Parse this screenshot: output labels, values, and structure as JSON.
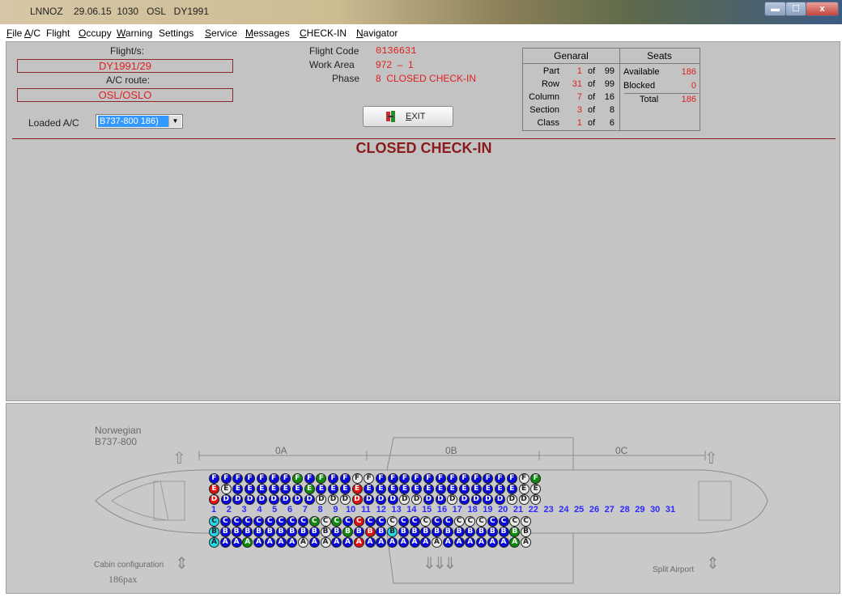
{
  "window": {
    "title": "LNNOZ    29.06.15  1030   OSL   DY1991",
    "minimize_label": "",
    "maximize_label": "",
    "close_label": "x"
  },
  "menu": [
    {
      "label": "File",
      "accel": "F",
      "rest": "ile"
    },
    {
      "label": "A/C",
      "accel": "A",
      "rest": "/C"
    },
    {
      "label": "Flight",
      "accel": "",
      "rest": "Flight"
    },
    {
      "label": "Occupy",
      "accel": "O",
      "rest": "ccupy"
    },
    {
      "label": "Warning",
      "accel": "W",
      "rest": "arning"
    },
    {
      "label": "Settings",
      "accel": "",
      "rest": "Settings"
    },
    {
      "label": "Service",
      "accel": "S",
      "rest": "ervice"
    },
    {
      "label": "Messages",
      "accel": "M",
      "rest": "essages"
    },
    {
      "label": "CHECK-IN",
      "accel": "C",
      "rest": "HECK-IN"
    },
    {
      "label": "Navigator",
      "accel": "N",
      "rest": "avigator"
    }
  ],
  "flight": {
    "flights_label": "Flight/s:",
    "flights_value": "DY1991/29",
    "route_label": "A/C route:",
    "route_value": "OSL/OSLO",
    "loaded_label": "Loaded A/C",
    "loaded_value": "B737-800 186)",
    "flight_code_label": "Flight Code",
    "flight_code_value": "0136631",
    "work_area_label": "Work Area",
    "work_area_value": "972  –  1",
    "phase_label": "Phase",
    "phase_value": "8  CLOSED CHECK-IN"
  },
  "exit_button": {
    "accel": "E",
    "rest": "XIT"
  },
  "general": {
    "header": "Genaral",
    "rows": [
      {
        "label": "Part",
        "value": "1",
        "total": "99"
      },
      {
        "label": "Row",
        "value": "31",
        "total": "99"
      },
      {
        "label": "Column",
        "value": "7",
        "total": "16"
      },
      {
        "label": "Section",
        "value": "3",
        "total": "8"
      },
      {
        "label": "Class",
        "value": "1",
        "total": "6"
      }
    ],
    "of_word": "of"
  },
  "seats": {
    "header": "Seats",
    "available_label": "Available",
    "available_value": "186",
    "blocked_label": "Blocked",
    "blocked_value": "0",
    "total_label": "Total",
    "total_value": "186"
  },
  "status_title": "CLOSED CHECK-IN",
  "aircraft": {
    "airline": "Norwegian",
    "type": "B737-800",
    "section_labels": [
      "0A",
      "0B",
      "0C"
    ],
    "cabin_config_label": "Cabin configuration",
    "pax_label": "186pax",
    "split_label": "Split Airport"
  },
  "seatmap": {
    "colors": {
      "blue": "#0a0ae0",
      "green": "#0e8a0e",
      "white": "#e8e8e8",
      "red": "#e01010",
      "cyan": "#26d9e6"
    },
    "row_numbers": [
      "1",
      "2",
      "3",
      "4",
      "5",
      "6",
      "7",
      "8",
      "9",
      "10",
      "11",
      "12",
      "13",
      "14",
      "15",
      "16",
      "17",
      "18",
      "19",
      "20",
      "21",
      "22",
      "23",
      "24",
      "25",
      "26",
      "27",
      "28",
      "29",
      "30",
      "31"
    ],
    "upper_rows": [
      {
        "letter": "F",
        "colors": "BBBBBBBGBGBBWWBBBBBBBBBBBBWG"
      },
      {
        "letter": "E",
        "colors": "RWBBBBBBGBBBRBBBBBBBBBBBBBWW"
      },
      {
        "letter": "D",
        "colors": "RBBBBBBBBWWWRBBBWWBBWBBBBWWW"
      }
    ],
    "lower_rows": [
      {
        "letter": "C",
        "colors": "CBBBBBBBBGWGBRBBWBBWBBWWWBBWW"
      },
      {
        "letter": "B",
        "colors": "CBBBBBBBBBWBGBRBCBBBBBBBBBBGW"
      },
      {
        "letter": "A",
        "colors": "CBBGBBBBWBWBBRBBBBBBWBBBBBBGW"
      }
    ]
  }
}
